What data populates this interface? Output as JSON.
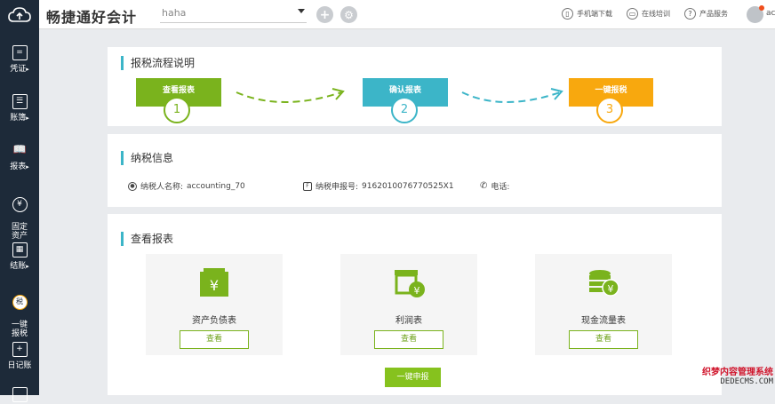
{
  "topbar": {
    "brand": "畅捷通好会计",
    "company": "haha",
    "links": [
      "手机端下载",
      "在线培训",
      "产品服务"
    ],
    "user": "ac",
    "add_glyph": "+",
    "settings_glyph": "⚙"
  },
  "sidebar": {
    "items": [
      {
        "label": "凭证",
        "arrow": "▸",
        "icon": "voucher-icon",
        "glyph": "="
      },
      {
        "label": "账簿",
        "arrow": "▸",
        "icon": "ledger-icon",
        "glyph": "☰"
      },
      {
        "label": "报表",
        "arrow": "▸",
        "icon": "report-book-icon",
        "glyph": "📖"
      },
      {
        "label": "固定\n资产",
        "arrow": "",
        "icon": "fixed-asset-icon",
        "glyph": "¥"
      },
      {
        "label": "结账",
        "arrow": "▸",
        "icon": "closing-icon",
        "glyph": "▦"
      },
      {
        "label": "一键\n报税",
        "arrow": "",
        "icon": "one-click-tax-icon",
        "glyph": "税"
      },
      {
        "label": "日记账",
        "arrow": "",
        "icon": "journal-icon",
        "glyph": "+"
      }
    ]
  },
  "process": {
    "title": "报税流程说明",
    "steps": [
      {
        "label": "查看报表",
        "num": "1",
        "color": "#7ab31d"
      },
      {
        "label": "确认报表",
        "num": "2",
        "color": "#3cb5c8"
      },
      {
        "label": "一键报税",
        "num": "3",
        "color": "#f8a80e"
      }
    ]
  },
  "taxinfo": {
    "title": "纳税信息",
    "name_label": "纳税人名称:",
    "name_value": "accounting_70",
    "id_label": "纳税申报号:",
    "id_value": "9162010076770525X1",
    "phone_label": "电话:"
  },
  "reports": {
    "title": "查看报表",
    "items": [
      {
        "name": "资产负债表",
        "view": "查看",
        "icon": "balance-sheet-icon"
      },
      {
        "name": "利润表",
        "view": "查看",
        "icon": "profit-statement-icon"
      },
      {
        "name": "现金流量表",
        "view": "查看",
        "icon": "cash-flow-icon"
      }
    ],
    "declare_label": "一键申报"
  },
  "watermark": {
    "line1": "织梦内容管理系统",
    "line2": "DEDECMS.COM"
  },
  "colors": {
    "green": "#7ab31d",
    "cyan": "#3cb5c8",
    "orange": "#f8a80e",
    "sidebar": "#1d2a39"
  }
}
